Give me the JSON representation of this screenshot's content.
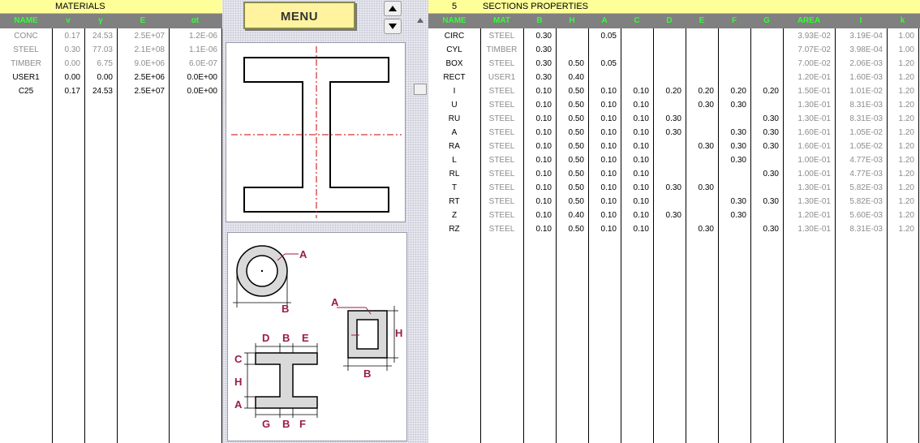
{
  "materials": {
    "title": "MATERIALS",
    "headers": [
      "NAME",
      "v",
      "γ",
      "E",
      "αt"
    ],
    "rows": [
      {
        "name": "CONC",
        "v": "0.17",
        "g": "24.53",
        "e": "2.5E+07",
        "a": "1.2E-06",
        "style": "grey"
      },
      {
        "name": "STEEL",
        "v": "0.30",
        "g": "77.03",
        "e": "2.1E+08",
        "a": "1.1E-06",
        "style": "grey"
      },
      {
        "name": "TIMBER",
        "v": "0.00",
        "g": "6.75",
        "e": "9.0E+06",
        "a": "6.0E-07",
        "style": "grey"
      },
      {
        "name": "USER1",
        "v": "0.00",
        "g": "0.00",
        "e": "2.5E+06",
        "a": "0.0E+00",
        "style": "blk"
      },
      {
        "name": "C25",
        "v": "0.17",
        "g": "24.53",
        "e": "2.5E+07",
        "a": "0.0E+00",
        "style": "blk"
      }
    ]
  },
  "menu": {
    "label": "MENU"
  },
  "legend": {
    "labels": [
      "A",
      "B",
      "A",
      "H",
      "B",
      "D",
      "B",
      "E",
      "C",
      "H",
      "A",
      "G",
      "B",
      "F"
    ]
  },
  "sections": {
    "count": "5",
    "title": "SECTIONS PROPERTIES",
    "headers": [
      "NAME",
      "MAT",
      "B",
      "H",
      "A",
      "C",
      "D",
      "E",
      "F",
      "G",
      "AREA",
      "I",
      "k"
    ],
    "rows": [
      {
        "name": "CIRC",
        "mat": "STEEL",
        "b": "0.30",
        "h": "",
        "a": "0.05",
        "c": "",
        "d": "",
        "e": "",
        "f": "",
        "g": "",
        "area": "3.93E-02",
        "i": "3.19E-04",
        "k": "1.00"
      },
      {
        "name": "CYL",
        "mat": "TIMBER",
        "b": "0.30",
        "h": "",
        "a": "",
        "c": "",
        "d": "",
        "e": "",
        "f": "",
        "g": "",
        "area": "7.07E-02",
        "i": "3.98E-04",
        "k": "1.00"
      },
      {
        "name": "BOX",
        "mat": "STEEL",
        "b": "0.30",
        "h": "0.50",
        "a": "0.05",
        "c": "",
        "d": "",
        "e": "",
        "f": "",
        "g": "",
        "area": "7.00E-02",
        "i": "2.06E-03",
        "k": "1.20"
      },
      {
        "name": "RECT",
        "mat": "USER1",
        "b": "0.30",
        "h": "0.40",
        "a": "",
        "c": "",
        "d": "",
        "e": "",
        "f": "",
        "g": "",
        "area": "1.20E-01",
        "i": "1.60E-03",
        "k": "1.20"
      },
      {
        "name": "I",
        "mat": "STEEL",
        "b": "0.10",
        "h": "0.50",
        "a": "0.10",
        "c": "0.10",
        "d": "0.20",
        "e": "0.20",
        "f": "0.20",
        "g": "0.20",
        "area": "1.50E-01",
        "i": "1.01E-02",
        "k": "1.20"
      },
      {
        "name": "U",
        "mat": "STEEL",
        "b": "0.10",
        "h": "0.50",
        "a": "0.10",
        "c": "0.10",
        "d": "",
        "e": "0.30",
        "f": "0.30",
        "g": "",
        "area": "1.30E-01",
        "i": "8.31E-03",
        "k": "1.20"
      },
      {
        "name": "RU",
        "mat": "STEEL",
        "b": "0.10",
        "h": "0.50",
        "a": "0.10",
        "c": "0.10",
        "d": "0.30",
        "e": "",
        "f": "",
        "g": "0.30",
        "area": "1.30E-01",
        "i": "8.31E-03",
        "k": "1.20"
      },
      {
        "name": "A",
        "mat": "STEEL",
        "b": "0.10",
        "h": "0.50",
        "a": "0.10",
        "c": "0.10",
        "d": "0.30",
        "e": "",
        "f": "0.30",
        "g": "0.30",
        "area": "1.60E-01",
        "i": "1.05E-02",
        "k": "1.20"
      },
      {
        "name": "RA",
        "mat": "STEEL",
        "b": "0.10",
        "h": "0.50",
        "a": "0.10",
        "c": "0.10",
        "d": "",
        "e": "0.30",
        "f": "0.30",
        "g": "0.30",
        "area": "1.60E-01",
        "i": "1.05E-02",
        "k": "1.20"
      },
      {
        "name": "L",
        "mat": "STEEL",
        "b": "0.10",
        "h": "0.50",
        "a": "0.10",
        "c": "0.10",
        "d": "",
        "e": "",
        "f": "0.30",
        "g": "",
        "area": "1.00E-01",
        "i": "4.77E-03",
        "k": "1.20"
      },
      {
        "name": "RL",
        "mat": "STEEL",
        "b": "0.10",
        "h": "0.50",
        "a": "0.10",
        "c": "0.10",
        "d": "",
        "e": "",
        "f": "",
        "g": "0.30",
        "area": "1.00E-01",
        "i": "4.77E-03",
        "k": "1.20"
      },
      {
        "name": "T",
        "mat": "STEEL",
        "b": "0.10",
        "h": "0.50",
        "a": "0.10",
        "c": "0.10",
        "d": "0.30",
        "e": "0.30",
        "f": "",
        "g": "",
        "area": "1.30E-01",
        "i": "5.82E-03",
        "k": "1.20"
      },
      {
        "name": "RT",
        "mat": "STEEL",
        "b": "0.10",
        "h": "0.50",
        "a": "0.10",
        "c": "0.10",
        "d": "",
        "e": "",
        "f": "0.30",
        "g": "0.30",
        "area": "1.30E-01",
        "i": "5.82E-03",
        "k": "1.20"
      },
      {
        "name": "Z",
        "mat": "STEEL",
        "b": "0.10",
        "h": "0.40",
        "a": "0.10",
        "c": "0.10",
        "d": "0.30",
        "e": "",
        "f": "0.30",
        "g": "",
        "area": "1.20E-01",
        "i": "5.60E-03",
        "k": "1.20"
      },
      {
        "name": "RZ",
        "mat": "STEEL",
        "b": "0.10",
        "h": "0.50",
        "a": "0.10",
        "c": "0.10",
        "d": "",
        "e": "0.30",
        "f": "",
        "g": "0.30",
        "area": "1.30E-01",
        "i": "8.31E-03",
        "k": "1.20"
      }
    ]
  },
  "icons": {
    "up": "triangle-up-icon",
    "down": "triangle-down-icon"
  },
  "colors": {
    "title_bg": "#ffff99",
    "header_bg": "#808080",
    "header_text": "#33ff33",
    "dim_label": "#9b1b4b",
    "axis_line": "#cc0000"
  }
}
